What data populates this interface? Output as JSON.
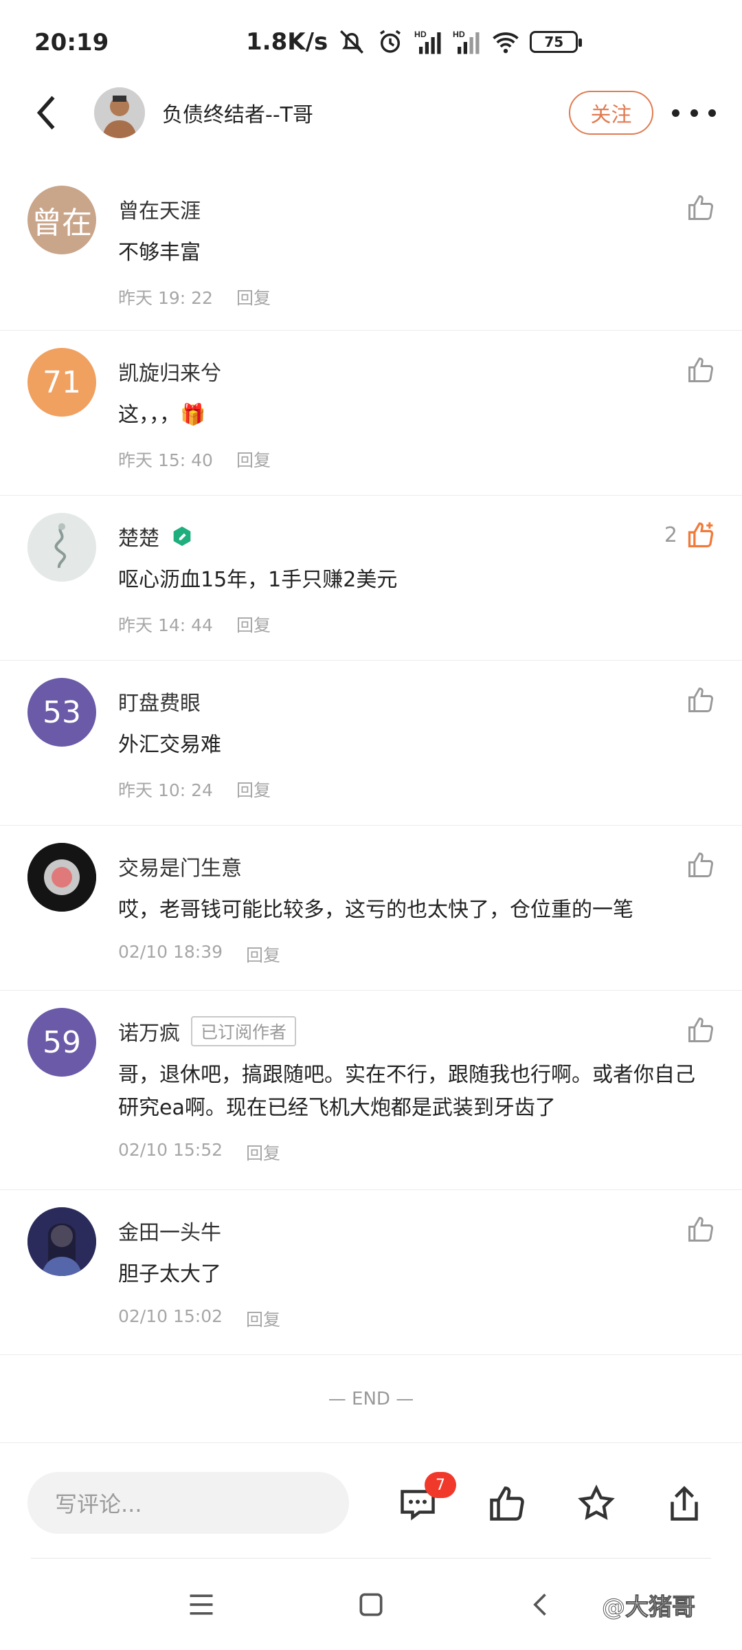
{
  "status_bar": {
    "time": "20:19",
    "net_speed": "1.8K/s",
    "battery": "75",
    "icons": [
      "mute-icon",
      "alarm-icon",
      "signal-hd-icon",
      "signal-hd-icon",
      "wifi-icon",
      "battery-icon"
    ]
  },
  "header": {
    "author_name": "负债终结者--T哥",
    "follow_label": "关注"
  },
  "comments": [
    {
      "avatar_text": "曾在",
      "avatar_color": "#c9a58a",
      "name": "曾在天涯",
      "text": "不够丰富",
      "time": "昨天 19: 22",
      "reply": "回复",
      "likes": "",
      "liked": false
    },
    {
      "avatar_text": "71",
      "avatar_color": "#f0a05f",
      "name": "凯旋归来兮",
      "text": "这，，，🎁",
      "time": "昨天 15: 40",
      "reply": "回复",
      "likes": "",
      "liked": false
    },
    {
      "avatar_text": "",
      "avatar_color": "#e9ecec",
      "name": "楚楚",
      "text": "呕心沥血15年，1手只赚2美元",
      "time": "昨天 14: 44",
      "reply": "回复",
      "likes": "2",
      "liked": true
    },
    {
      "avatar_text": "53",
      "avatar_color": "#6a5aa8",
      "name": "盯盘费眼",
      "text": "外汇交易难",
      "time": "昨天 10: 24",
      "reply": "回复",
      "likes": "",
      "liked": false
    },
    {
      "avatar_text": "",
      "avatar_color": "#1a1a1a",
      "name": "交易是门生意",
      "text": "哎，老哥钱可能比较多，这亏的也太快了，仓位重的一笔",
      "time": "02/10 18:39",
      "reply": "回复",
      "likes": "",
      "liked": false
    },
    {
      "avatar_text": "59",
      "avatar_color": "#6a5aa8",
      "name": "诺万疯",
      "badge": "已订阅作者",
      "text": "哥，退休吧，搞跟随吧。实在不行，跟随我也行啊。或者你自己研究ea啊。现在已经飞机大炮都是武装到牙齿了",
      "time": "02/10 15:52",
      "reply": "回复",
      "likes": "",
      "liked": false
    },
    {
      "avatar_text": "",
      "avatar_color": "#3b3a6e",
      "name": "金田一头牛",
      "text": "胆子太大了",
      "time": "02/10 15:02",
      "reply": "回复",
      "likes": "",
      "liked": false
    }
  ],
  "end_text": "— END —",
  "bottom_bar": {
    "input_placeholder": "写评论...",
    "comment_count": "7"
  },
  "watermark": "@大猪哥",
  "colors": {
    "accent": "#e07a4f",
    "liked": "#f07a3a",
    "badge_red": "#f0392b"
  }
}
